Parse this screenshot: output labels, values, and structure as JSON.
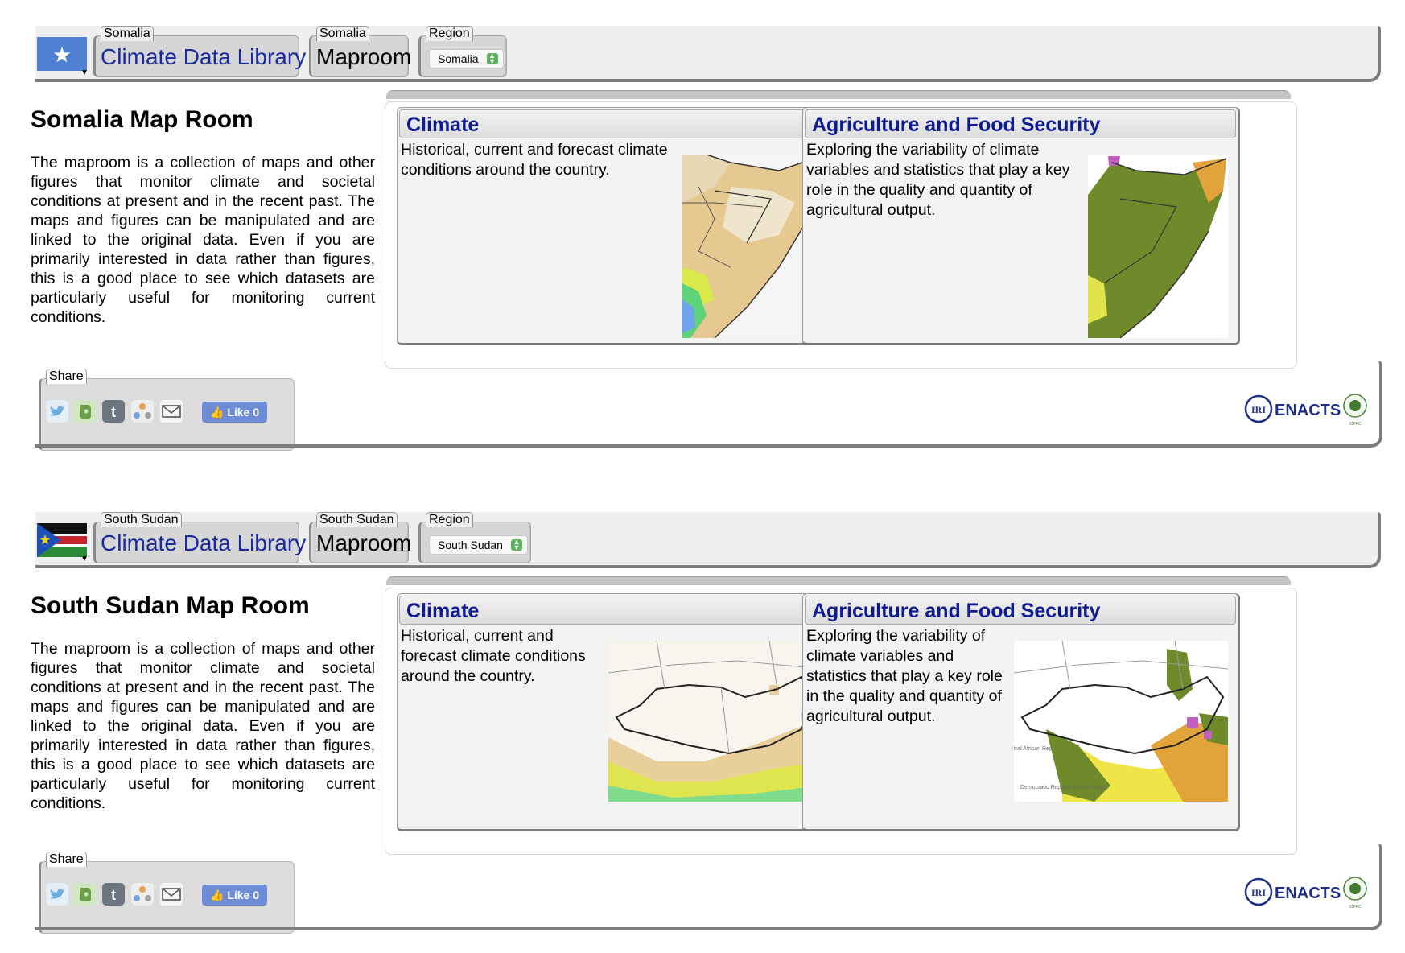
{
  "panels": [
    {
      "country": "Somalia",
      "nav": {
        "library_caption": "Somalia",
        "library_label": "Climate Data Library",
        "maproom_caption": "Somalia",
        "maproom_label": "Maproom",
        "region_caption": "Region",
        "region_value": "Somalia"
      },
      "title": "Somalia Map Room",
      "description": "The maproom is a collection of maps and other figures that monitor climate and societal conditions at present and in the recent past. The maps and figures can be manipulated and are linked to the original data. Even if you are primarily interested in data rather than figures, this is a good place to see which datasets are particularly useful for monitoring current conditions.",
      "cards": [
        {
          "title": "Climate",
          "text": "Historical, current and forecast climate conditions around the country."
        },
        {
          "title": "Agriculture and Food Security",
          "text": "Exploring the variability of climate variables and statistics that play a key role in the quality and quantity of agricultural output."
        }
      ],
      "share": {
        "caption": "Share",
        "like_label": "Like 0"
      },
      "logos": {
        "iri": "IRI",
        "enacts": "ENACTS",
        "icpac": "ICPAC"
      }
    },
    {
      "country": "South Sudan",
      "nav": {
        "library_caption": "South Sudan",
        "library_label": "Climate Data Library",
        "maproom_caption": "South Sudan",
        "maproom_label": "Maproom",
        "region_caption": "Region",
        "region_value": "South Sudan"
      },
      "title": "South Sudan Map Room",
      "description": "The maproom is a collection of maps and other figures that monitor climate and societal conditions at present and in the recent past. The maps and figures can be manipulated and are linked to the original data. Even if you are primarily interested in data rather than figures, this is a good place to see which datasets are particularly useful for monitoring current conditions.",
      "cards": [
        {
          "title": "Climate",
          "text": "Historical, current and forecast climate conditions around the country."
        },
        {
          "title": "Agriculture and Food Security",
          "text": "Exploring the variability of climate variables and statistics that play a key role in the quality and quantity of agricultural output."
        }
      ],
      "map_labels": {
        "car": "tral African Rep",
        "drc": "Democratic Republic of the Congo"
      },
      "share": {
        "caption": "Share",
        "like_label": "Like 0"
      },
      "logos": {
        "iri": "IRI",
        "enacts": "ENACTS",
        "icpac": "ICPAC"
      }
    }
  ],
  "colors": {
    "link_blue": "#1a2aa0",
    "card_title": "#0d1a90",
    "like_blue": "#6d8bd6",
    "select_green": "#5bb35b"
  },
  "icons": [
    "twitter-icon",
    "evernote-icon",
    "tumblr-icon",
    "share-network-icon",
    "email-icon",
    "facebook-like-icon"
  ]
}
